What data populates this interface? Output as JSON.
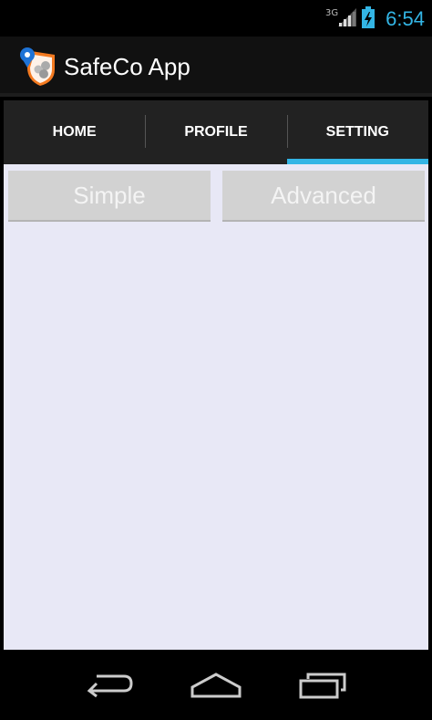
{
  "status_bar": {
    "network": "3G",
    "time": "6:54",
    "signal_icon": "signal-icon",
    "battery_icon": "battery-charging-icon"
  },
  "action_bar": {
    "title": "SafeCo App",
    "icon": "app-logo-icon"
  },
  "tabs": [
    {
      "label": "HOME",
      "active": false
    },
    {
      "label": "PROFILE",
      "active": false
    },
    {
      "label": "SETTING",
      "active": true
    }
  ],
  "settings": {
    "simple_label": "Simple",
    "advanced_label": "Advanced"
  },
  "nav_bar": {
    "back_icon": "back-icon",
    "home_icon": "home-icon",
    "recents_icon": "recents-icon"
  },
  "colors": {
    "accent": "#33b5e5",
    "content_bg": "#e8e8f6",
    "button_bg": "#d2d2d2"
  }
}
